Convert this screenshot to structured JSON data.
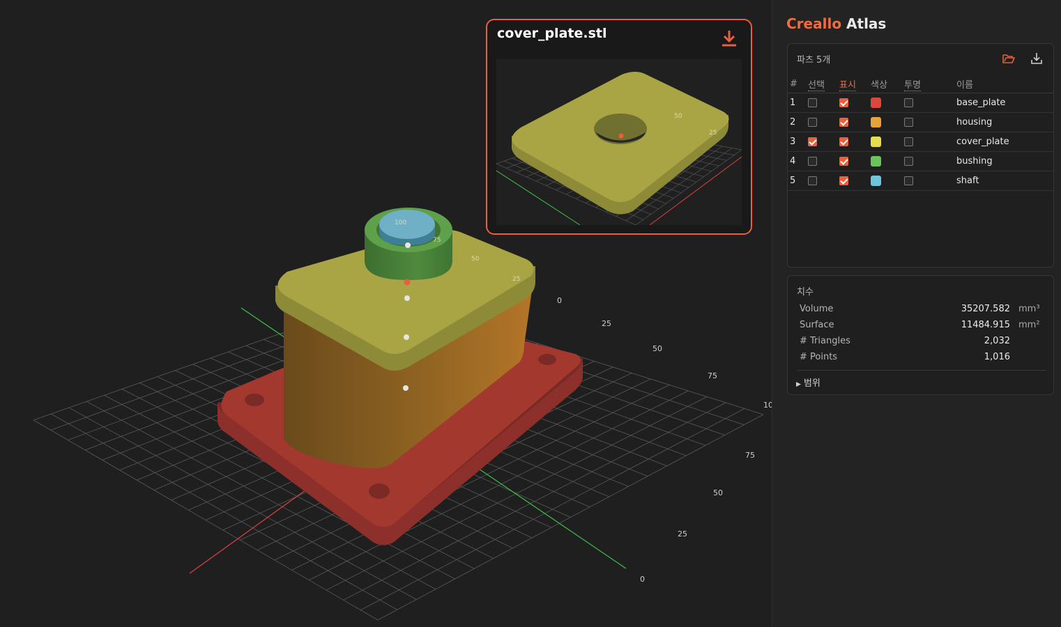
{
  "app": {
    "brand_part1": "Creallo",
    "brand_part2": "Atlas"
  },
  "preview": {
    "filename": "cover_plate.stl",
    "download_icon": "download-icon"
  },
  "viewport": {
    "axis_labels_right": [
      "0",
      "25",
      "50",
      "75",
      "10"
    ],
    "axis_labels_front": [
      "0",
      "25",
      "50",
      "75"
    ],
    "ring_labels": [
      "100",
      "75",
      "50",
      "25"
    ],
    "preview_ring_labels": [
      "50",
      "25"
    ]
  },
  "parts": {
    "title": "파츠 5개",
    "open_icon": "folder-open-icon",
    "download_icon": "download-icon",
    "headers": {
      "num": "#",
      "select": "선택",
      "display": "표시",
      "color": "색상",
      "transparent": "투명",
      "name": "이름"
    },
    "rows": [
      {
        "num": "1",
        "selected": false,
        "visible": true,
        "color": "#d9483b",
        "transparent": false,
        "name": "base_plate"
      },
      {
        "num": "2",
        "selected": false,
        "visible": true,
        "color": "#e8a23a",
        "transparent": false,
        "name": "housing"
      },
      {
        "num": "3",
        "selected": true,
        "visible": true,
        "color": "#e4de4e",
        "transparent": false,
        "name": "cover_plate"
      },
      {
        "num": "4",
        "selected": false,
        "visible": true,
        "color": "#6cc35c",
        "transparent": false,
        "name": "bushing"
      },
      {
        "num": "5",
        "selected": false,
        "visible": true,
        "color": "#6ec6dd",
        "transparent": false,
        "name": "shaft"
      }
    ]
  },
  "dims": {
    "title": "치수",
    "rows": [
      {
        "label": "Volume",
        "value": "35207.582",
        "unit": "mm³"
      },
      {
        "label": "Surface",
        "value": "11484.915",
        "unit": "mm²"
      },
      {
        "label": "# Triangles",
        "value": "2,032",
        "unit": ""
      },
      {
        "label": "# Points",
        "value": "1,016",
        "unit": ""
      }
    ],
    "range_label": "범위"
  },
  "colors": {
    "accent": "#e8603c",
    "base_plate": "#9b3530",
    "housing": "#b47528",
    "cover_plate": "#a9a545",
    "bushing": "#4f8a3d",
    "shaft": "#5f9ab0"
  }
}
